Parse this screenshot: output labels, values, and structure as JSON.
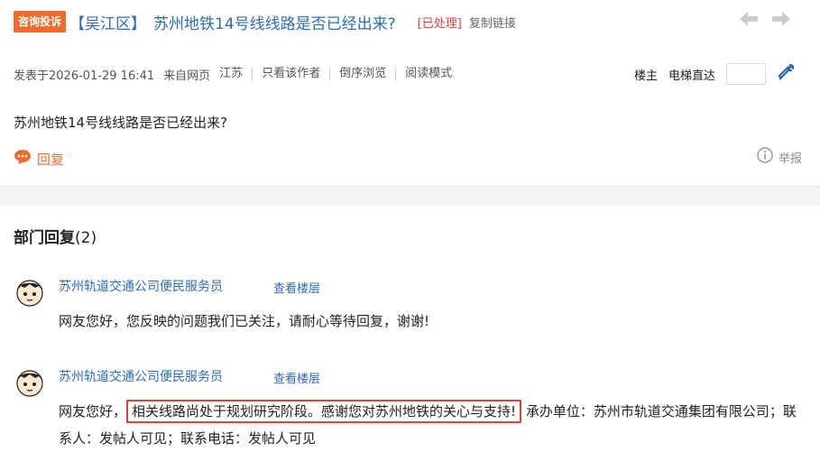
{
  "header": {
    "badge": "咨询投诉",
    "district": "【吴江区】",
    "title": "苏州地铁14号线线路是否已经出来?",
    "status": "[已处理]",
    "copy_link": "复制链接",
    "prev_icon": "arrow-left-icon",
    "next_icon": "arrow-right-icon"
  },
  "meta": {
    "posted": "发表于2026-01-29 16:41",
    "source": "来自网页",
    "region": "江苏",
    "only_author": "只看该作者",
    "reverse": "倒序浏览",
    "read_mode": "阅读模式",
    "owner": "楼主",
    "jump": "电梯直达",
    "jump_value": ""
  },
  "post": {
    "text": "苏州地铁14号线线路是否已经出来?",
    "reply_label": "回复",
    "report_label": "举报"
  },
  "replies_section": {
    "title": "部门回复",
    "count": "(2)",
    "items": [
      {
        "name": "苏州轨道交通公司便民服务员",
        "view": "查看楼层",
        "prefix": "网友您好，您反映的问题我们已关注，请耐心等待回复，谢谢!",
        "highlight": "",
        "suffix": ""
      },
      {
        "name": "苏州轨道交通公司便民服务员",
        "view": "查看楼层",
        "prefix": "网友您好，",
        "highlight": "相关线路尚处于规划研究阶段。感谢您对苏州地铁的关心与支持!",
        "suffix": "承办单位：苏州市轨道交通集团有限公司；联系人：发帖人可见；联系电话：发帖人可见"
      }
    ]
  },
  "colors": {
    "accent": "#f26b2e",
    "link": "#2b6cb8",
    "status": "#e0413a"
  }
}
